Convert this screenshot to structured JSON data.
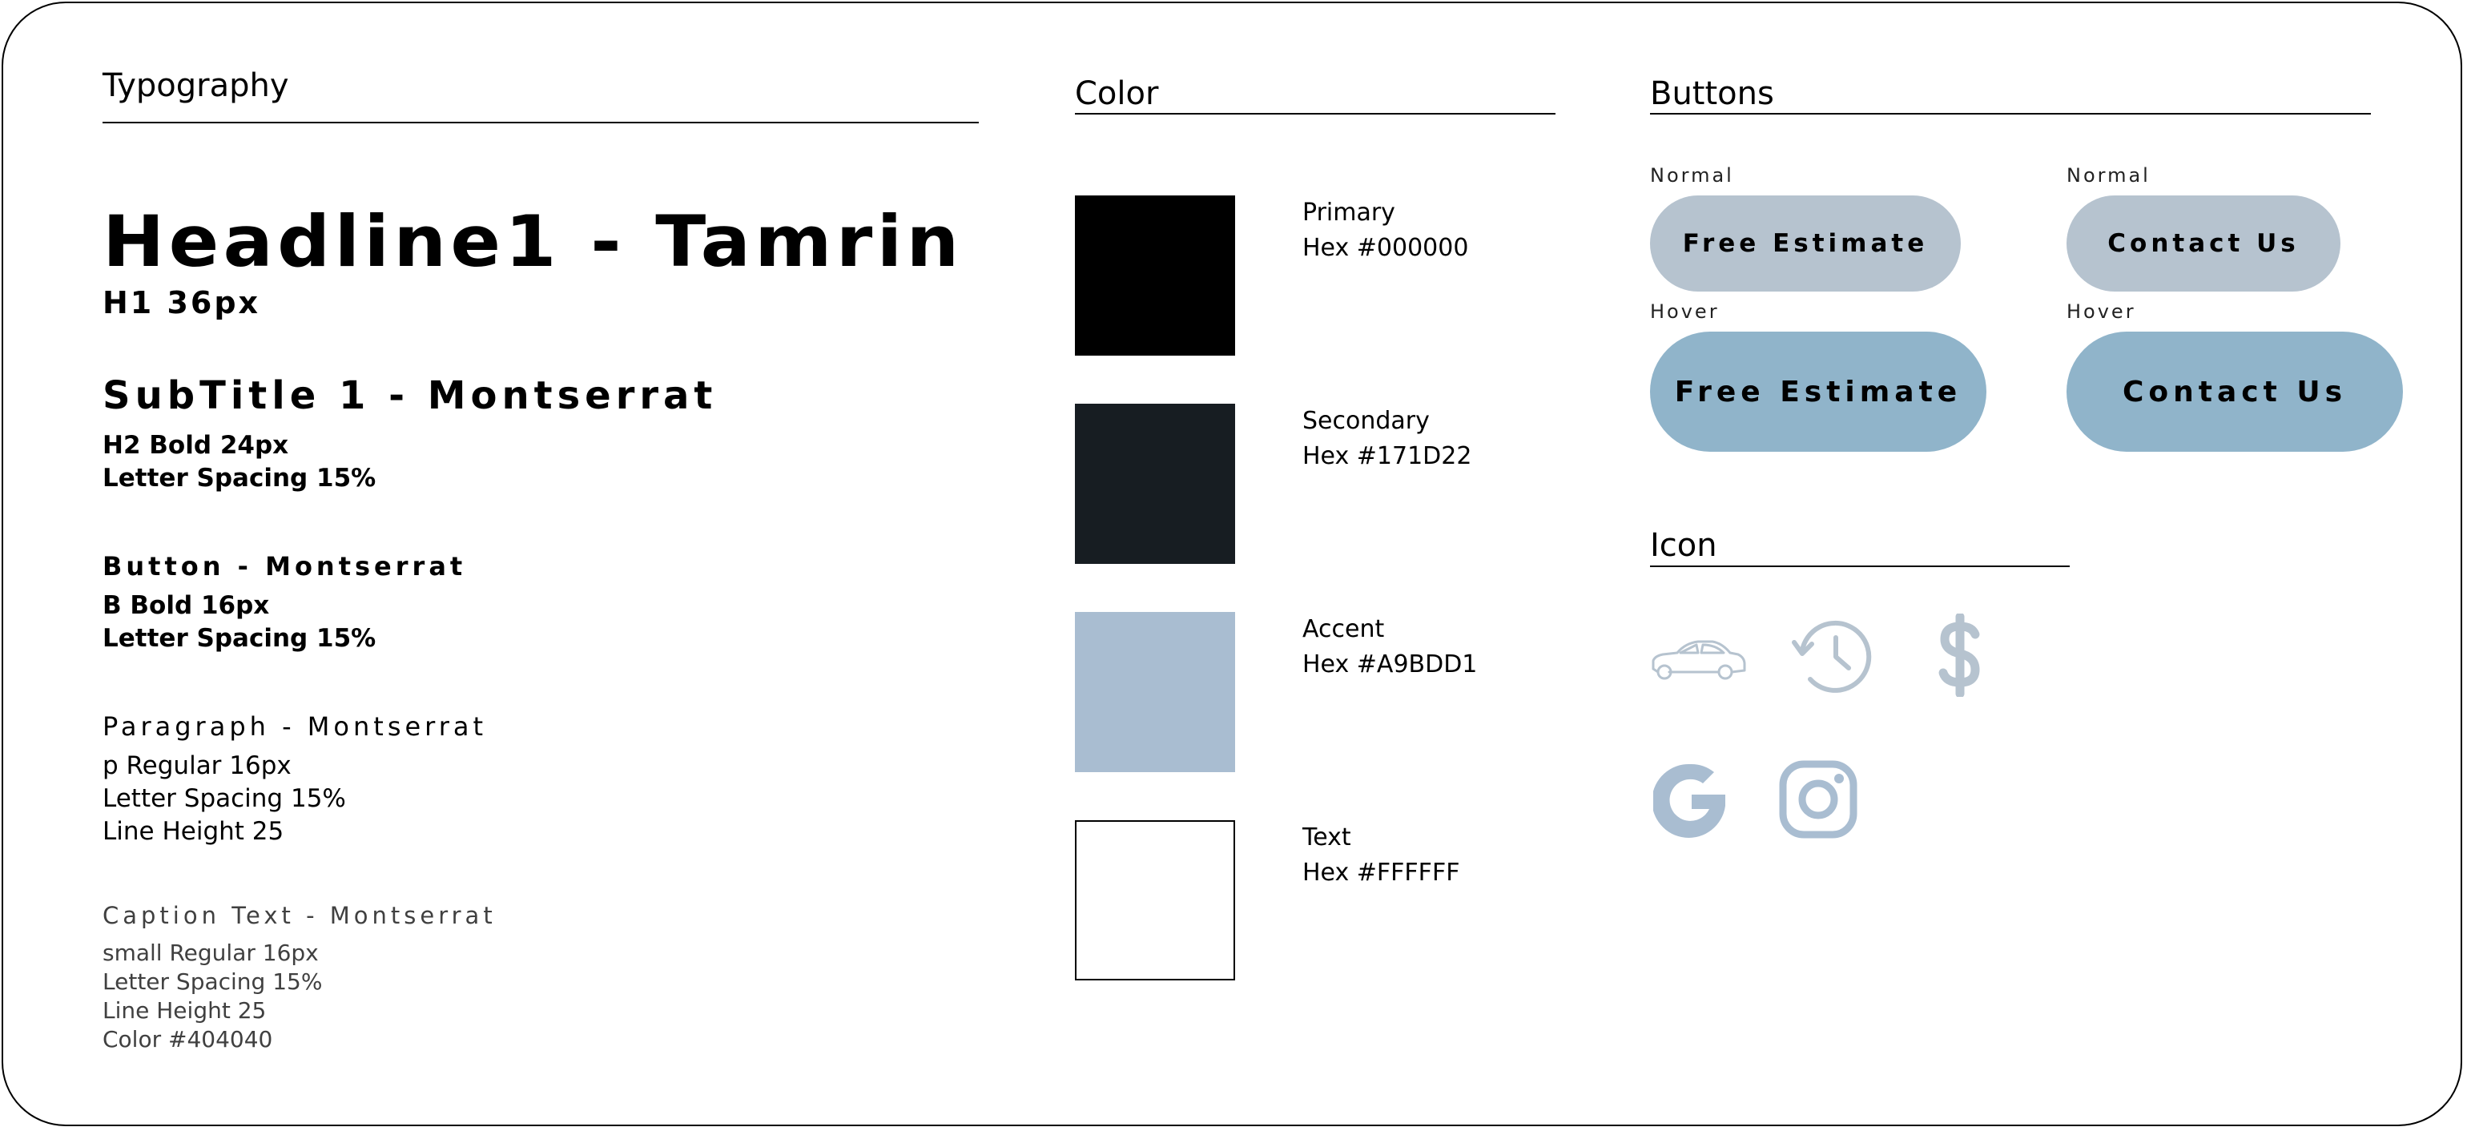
{
  "colors": {
    "primary": "#000000",
    "secondary": "#171D22",
    "accent": "#A9BDD1",
    "text": "#FFFFFF",
    "button_normal": "#B6C3CF",
    "button_hover": "#90B4CA",
    "icon": "#B6C3CF",
    "caption": "#404040"
  },
  "typography": {
    "title": "Typography",
    "h1": {
      "sample": "Headline1 - Tamrin",
      "spec": "H1 36px"
    },
    "subtitle": {
      "sample": "SubTitle 1 - Montserrat",
      "spec_1": "H2 Bold 24px",
      "spec_2": "Letter Spacing 15%"
    },
    "button": {
      "sample": "Button - Montserrat",
      "spec_1": "B Bold 16px",
      "spec_2": "Letter Spacing 15%"
    },
    "paragraph": {
      "sample": "Paragraph - Montserrat",
      "spec_1": "p Regular 16px",
      "spec_2": "Letter Spacing 15%",
      "spec_3": "Line Height 25"
    },
    "caption": {
      "sample": "Caption Text - Montserrat",
      "spec_1": "small Regular 16px",
      "spec_2": "Letter Spacing 15%",
      "spec_3": "Line Height 25",
      "spec_4": "Color #404040"
    }
  },
  "color_section": {
    "title": "Color",
    "swatches": [
      {
        "name": "Primary",
        "hex": "Hex #000000"
      },
      {
        "name": "Secondary",
        "hex": "Hex #171D22"
      },
      {
        "name": "Accent",
        "hex": "Hex #A9BDD1"
      },
      {
        "name": "Text",
        "hex": "Hex #FFFFFF"
      }
    ]
  },
  "buttons_section": {
    "title": "Buttons",
    "normal_label": "Normal",
    "hover_label": "Hover",
    "free_estimate": "Free Estimate",
    "contact_us": "Contact Us"
  },
  "icon_section": {
    "title": "Icon",
    "icons": [
      "car-icon",
      "history-icon",
      "dollar-icon",
      "google-icon",
      "instagram-icon"
    ]
  }
}
